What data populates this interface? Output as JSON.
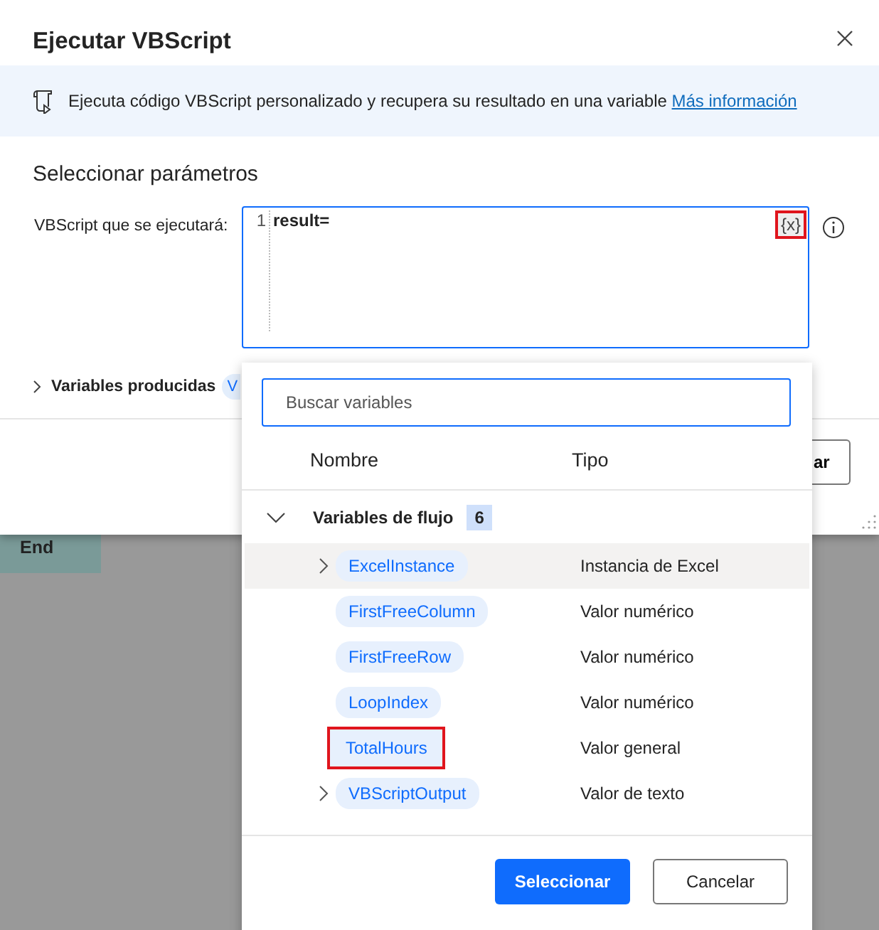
{
  "dialog": {
    "title": "Ejecutar VBScript",
    "info": {
      "text": "Ejecuta código VBScript personalizado y recupera su resultado en una variable",
      "link": "Más información"
    },
    "section_title": "Seleccionar parámetros",
    "script_field": {
      "label": "VBScript que se ejecutará:",
      "lines": [
        {
          "number": "1",
          "code": "result="
        }
      ],
      "variable_button": {
        "label": "{x}",
        "highlighted": true
      }
    },
    "produced_variables": {
      "label": "Variables producidas",
      "expanded": false,
      "chip": "V"
    },
    "footer_button": "ar"
  },
  "canvas": {
    "node": "End"
  },
  "variable_picker": {
    "search": {
      "placeholder": "Buscar variables"
    },
    "columns": [
      "Nombre",
      "Tipo"
    ],
    "groups": [
      {
        "name": "Variables de flujo",
        "count": "6",
        "expanded": true,
        "children": [
          {
            "name": "ExcelInstance",
            "type": "Instancia de Excel",
            "expandable": true,
            "hovered": true,
            "highlighted": false
          },
          {
            "name": "FirstFreeColumn",
            "type": "Valor numérico",
            "expandable": false,
            "hovered": false,
            "highlighted": false
          },
          {
            "name": "FirstFreeRow",
            "type": "Valor numérico",
            "expandable": false,
            "hovered": false,
            "highlighted": false
          },
          {
            "name": "LoopIndex",
            "type": "Valor numérico",
            "expandable": false,
            "hovered": false,
            "highlighted": false
          },
          {
            "name": "TotalHours",
            "type": "Valor general",
            "expandable": false,
            "hovered": false,
            "highlighted": true
          },
          {
            "name": "VBScriptOutput",
            "type": "Valor de texto",
            "expandable": true,
            "hovered": false,
            "highlighted": false
          }
        ]
      }
    ],
    "buttons": [
      {
        "label": "Seleccionar",
        "kind": "primary"
      },
      {
        "label": "Cancelar",
        "kind": "secondary"
      }
    ]
  }
}
